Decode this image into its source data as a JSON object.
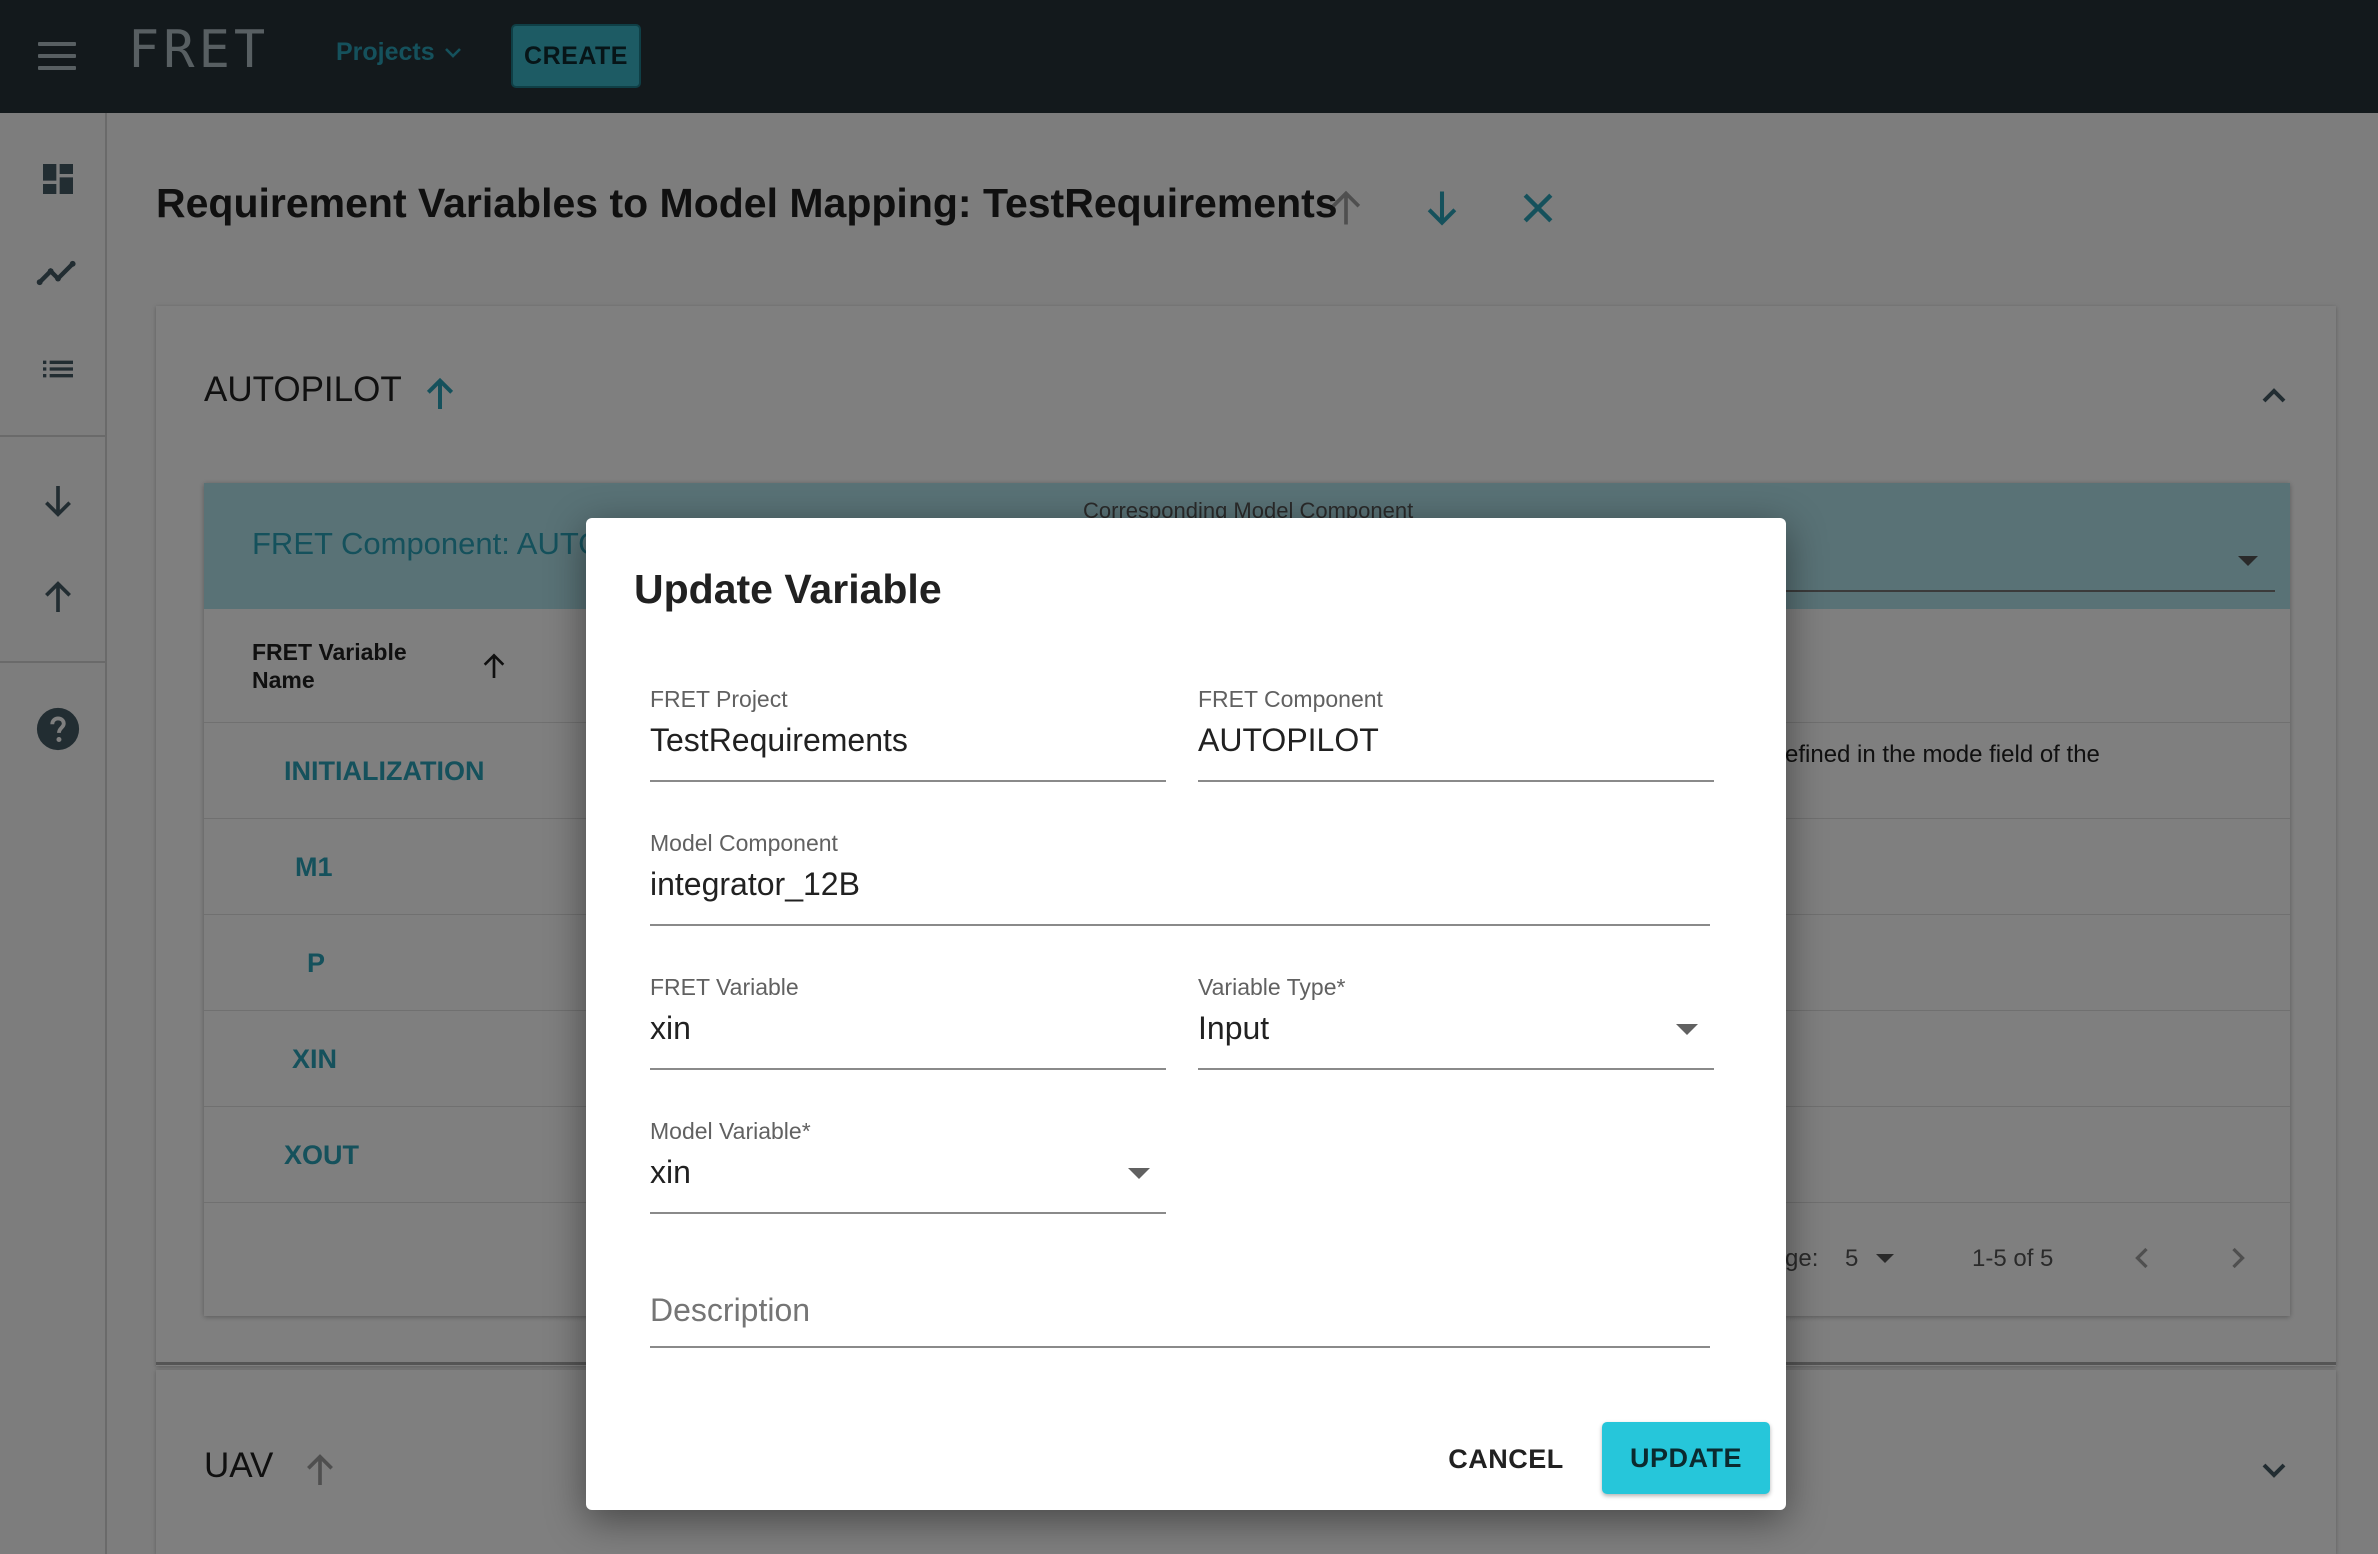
{
  "app": {
    "logo": "FRET",
    "projects_label": "Projects",
    "create_label": "CREATE"
  },
  "page": {
    "title": "Requirement Variables to Model Mapping: TestRequirements"
  },
  "components": [
    {
      "name": "AUTOPILOT",
      "header_title": "FRET Component: AUTO",
      "corresponding_label": "Corresponding Model Component",
      "variable_name_header_line1": "FRET Variable",
      "variable_name_header_line2": "Name",
      "rows": [
        "INITIALIZATION",
        "M1",
        "P",
        "XIN",
        "XOUT"
      ],
      "visible_description_fragment": "efined in the mode field of the",
      "rows_per_page_label": "ge:",
      "rows_per_page": "5",
      "pagination": "1-5 of 5"
    },
    {
      "name": "UAV"
    }
  ],
  "dialog": {
    "title": "Update Variable",
    "fret_project": {
      "label": "FRET Project",
      "value": "TestRequirements"
    },
    "fret_component": {
      "label": "FRET Component",
      "value": "AUTOPILOT"
    },
    "model_component": {
      "label": "Model Component",
      "value": "integrator_12B"
    },
    "fret_variable": {
      "label": "FRET Variable",
      "value": "xin"
    },
    "variable_type": {
      "label": "Variable Type*",
      "value": "Input"
    },
    "model_variable": {
      "label": "Model Variable*",
      "value": "xin"
    },
    "description": {
      "placeholder": "Description"
    },
    "cancel_label": "CANCEL",
    "update_label": "UPDATE"
  },
  "colors": {
    "appbar": "#263238",
    "accent": "#2aa3b8",
    "update_button": "#26c6da"
  },
  "icons": {
    "menu": "menu-icon",
    "dashboard": "dashboard-icon",
    "analysis": "timeline-icon",
    "list": "list-icon",
    "import": "arrow-down-icon",
    "export": "arrow-up-icon",
    "help": "help-icon",
    "close": "close-icon"
  }
}
